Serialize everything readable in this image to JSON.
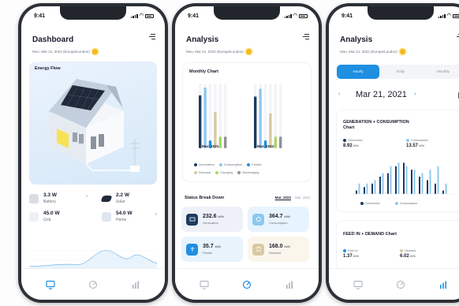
{
  "status": {
    "time": "9:41"
  },
  "date": "Mon, Mar 21, 2022 (Europe/London)",
  "dashboard": {
    "title": "Dashboard",
    "energy_flow_title": "Energy Flow",
    "stats": [
      {
        "value": "3.3 W",
        "label": "Battery"
      },
      {
        "value": "2.2 W",
        "label": "Solar"
      },
      {
        "value": "45.0 W",
        "label": "Grid"
      },
      {
        "value": "54.0 W",
        "label": "Home"
      }
    ]
  },
  "analysis": {
    "title": "Analysis",
    "monthly_chart_title": "Monthly Chart",
    "month_labels": [
      "Mar. 2021",
      "Mar. 2022"
    ],
    "legend": [
      {
        "label": "Generation",
        "color": "#1e3a5f"
      },
      {
        "label": "Consumption",
        "color": "#8ec8ee"
      },
      {
        "label": "Feedin",
        "color": "#1e8fe1"
      },
      {
        "label": "Demand",
        "color": "#d9c9a3"
      },
      {
        "label": "Charging",
        "color": "#a8d86a"
      },
      {
        "label": "Discharging",
        "color": "#8e9396"
      }
    ],
    "status_breakdown_title": "Status Break Down",
    "breakdown_tabs": [
      "Mar. 2022",
      "Mar. 2021"
    ],
    "tiles": [
      {
        "value": "232.6",
        "unit": "kWh",
        "label": "Generation",
        "bg": "#eef2f8",
        "icon_bg": "#1e3a5f"
      },
      {
        "value": "364.7",
        "unit": "kWh",
        "label": "Consumption",
        "bg": "#e8f4fd",
        "icon_bg": "#8ec8ee"
      },
      {
        "value": "35.7",
        "unit": "kWh",
        "label": "Feedin",
        "bg": "#e8f3fc",
        "icon_bg": "#1e8fe1"
      },
      {
        "value": "168.0",
        "unit": "kWh",
        "label": "Demand",
        "bg": "#faf6ec",
        "icon_bg": "#d9c9a3"
      }
    ]
  },
  "detail": {
    "title": "Analysis",
    "tabs": [
      "Hourly",
      "Daily",
      "Monthly"
    ],
    "date": "Mar 21, 2021",
    "gen_card_title": "GENERATION + CONSUMPTION Chart",
    "generation": {
      "label": "Generation",
      "value": "8.92",
      "unit": "kWh"
    },
    "consumption": {
      "label": "Consumption",
      "value": "13.57",
      "unit": "kWh"
    },
    "mini_legend": [
      "Generation",
      "Consumption"
    ],
    "feed_card_title": "FEED IN + DEMAND Chart",
    "feedin": {
      "label": "Feed in",
      "value": "1.37",
      "unit": "kWh"
    },
    "demand": {
      "label": "Demand",
      "value": "6.02",
      "unit": "kWh"
    }
  },
  "chart_data": [
    {
      "type": "bar",
      "categories": [
        "Mar. 2021",
        "Mar. 2022"
      ],
      "series": [
        {
          "name": "Generation",
          "values": [
            82,
            80
          ]
        },
        {
          "name": "Consumption",
          "values": [
            94,
            92
          ]
        },
        {
          "name": "Feedin",
          "values": [
            12,
            12
          ]
        },
        {
          "name": "Demand",
          "values": [
            56,
            54
          ]
        },
        {
          "name": "Charging",
          "values": [
            18,
            18
          ]
        },
        {
          "name": "Discharging",
          "values": [
            18,
            18
          ]
        }
      ],
      "title": "Monthly Chart",
      "ylim": [
        0,
        100
      ]
    },
    {
      "type": "bar",
      "title": "GENERATION + CONSUMPTION Chart",
      "series": [
        {
          "name": "Generation",
          "values": [
            0.1,
            0.2,
            0.3,
            0.5,
            0.6,
            0.8,
            0.9,
            0.7,
            0.5,
            0.4,
            0.3,
            0.1
          ]
        },
        {
          "name": "Consumption",
          "values": [
            0.3,
            0.3,
            0.4,
            0.6,
            0.8,
            0.9,
            0.8,
            0.7,
            0.6,
            0.7,
            0.8,
            0.3
          ]
        }
      ]
    }
  ]
}
